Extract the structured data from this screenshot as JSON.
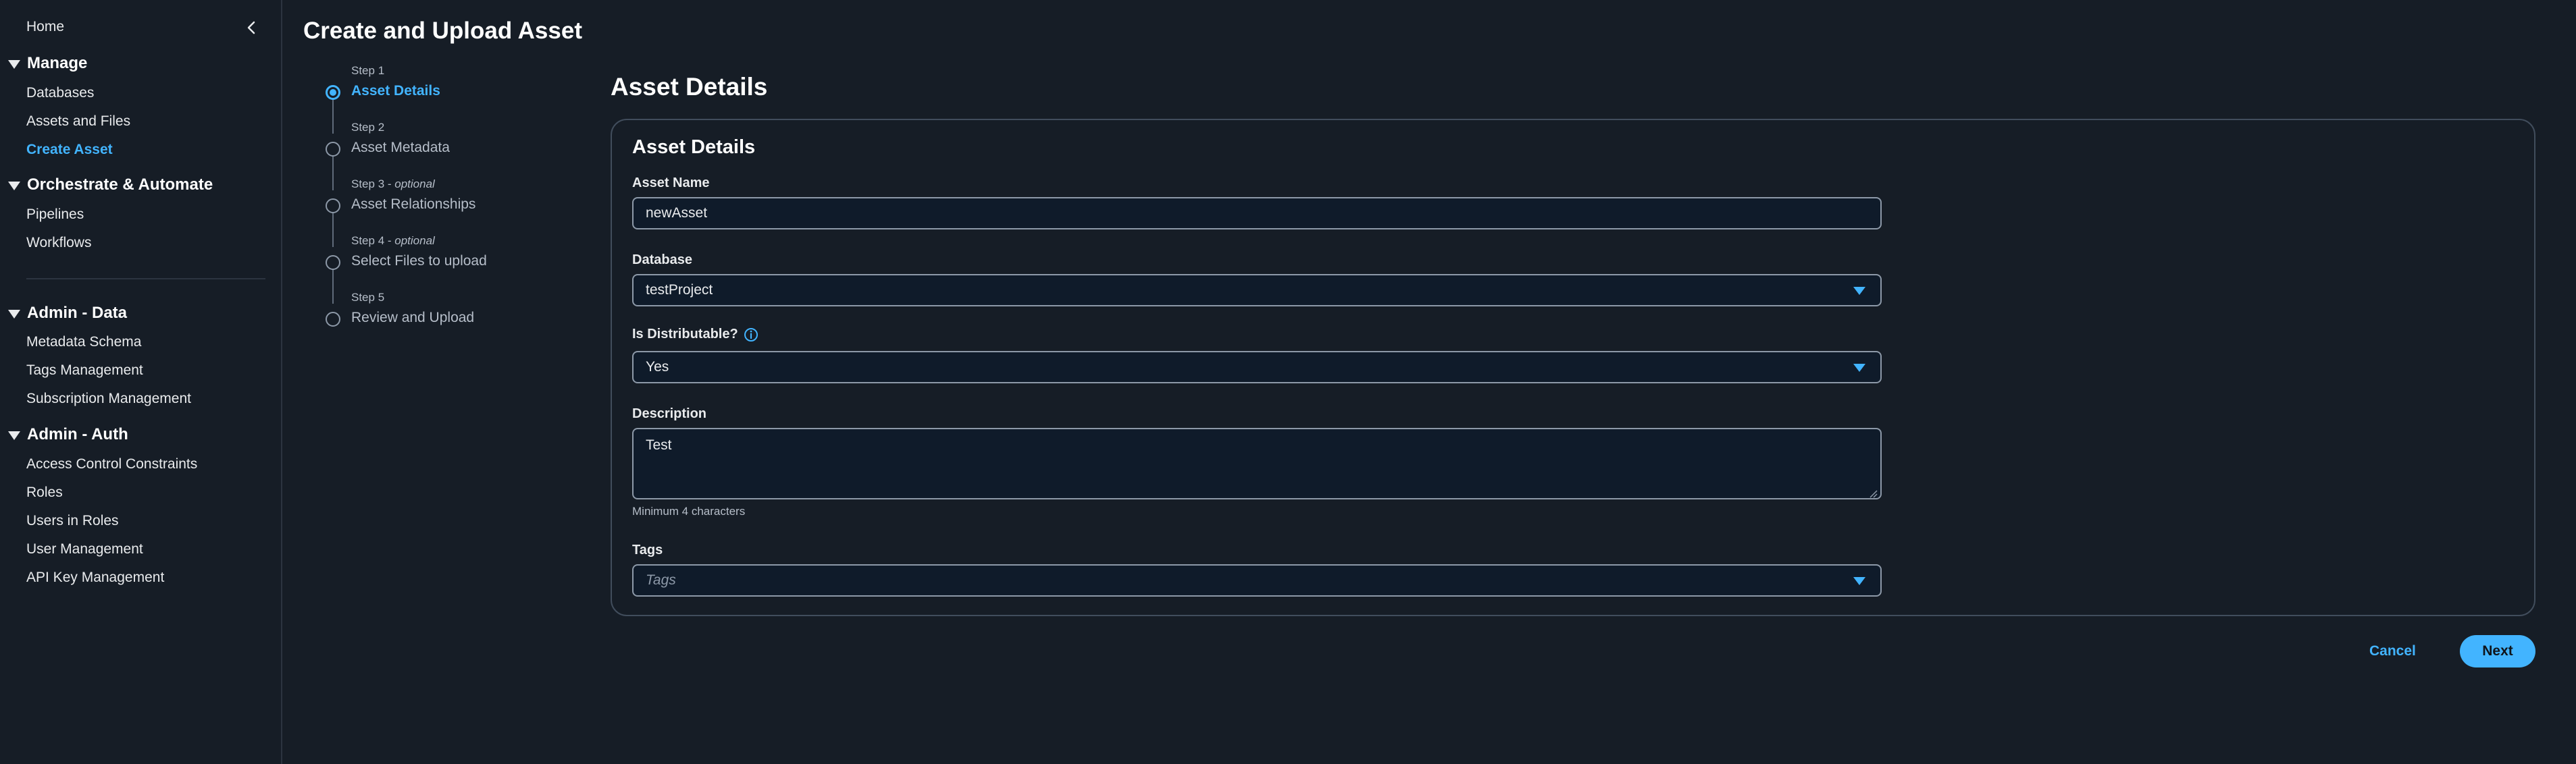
{
  "sidebar": {
    "home": "Home",
    "sections": [
      {
        "title": "Manage",
        "items": [
          "Databases",
          "Assets and Files",
          "Create Asset"
        ]
      },
      {
        "title": "Orchestrate & Automate",
        "items": [
          "Pipelines",
          "Workflows"
        ]
      },
      {
        "title": "Admin - Data",
        "items": [
          "Metadata Schema",
          "Tags Management",
          "Subscription Management"
        ]
      },
      {
        "title": "Admin - Auth",
        "items": [
          "Access Control Constraints",
          "Roles",
          "Users in Roles",
          "User Management",
          "API Key Management"
        ]
      }
    ],
    "active_item": "Create Asset"
  },
  "page": {
    "title": "Create and Upload Asset"
  },
  "stepper": {
    "steps": [
      {
        "caption": "Step 1",
        "optional": "",
        "label": "Asset Details"
      },
      {
        "caption": "Step 2",
        "optional": "",
        "label": "Asset Metadata"
      },
      {
        "caption": "Step 3",
        "optional": "optional",
        "label": "Asset Relationships"
      },
      {
        "caption": "Step 4",
        "optional": "optional",
        "label": "Select Files to upload"
      },
      {
        "caption": "Step 5",
        "optional": "",
        "label": "Review and Upload"
      }
    ],
    "optional_separator": " - "
  },
  "main": {
    "heading": "Asset Details",
    "card_title": "Asset Details",
    "fields": {
      "asset_name": {
        "label": "Asset Name",
        "value": "newAsset"
      },
      "database": {
        "label": "Database",
        "value": "testProject"
      },
      "is_distributable": {
        "label": "Is Distributable?",
        "value": "Yes"
      },
      "description": {
        "label": "Description",
        "value": "Test",
        "hint": "Minimum 4 characters"
      },
      "tags": {
        "label": "Tags",
        "placeholder": "Tags"
      }
    }
  },
  "footer": {
    "cancel": "Cancel",
    "next": "Next"
  },
  "colors": {
    "background": "#161d26",
    "accent": "#42b4ff",
    "text": "#e9ebed",
    "border": "#414d5c"
  },
  "icons": {
    "collapse": "chevron-left-icon",
    "section_toggle": "caret-down-icon",
    "info": "info-circle-icon",
    "dropdown": "caret-down-icon"
  }
}
